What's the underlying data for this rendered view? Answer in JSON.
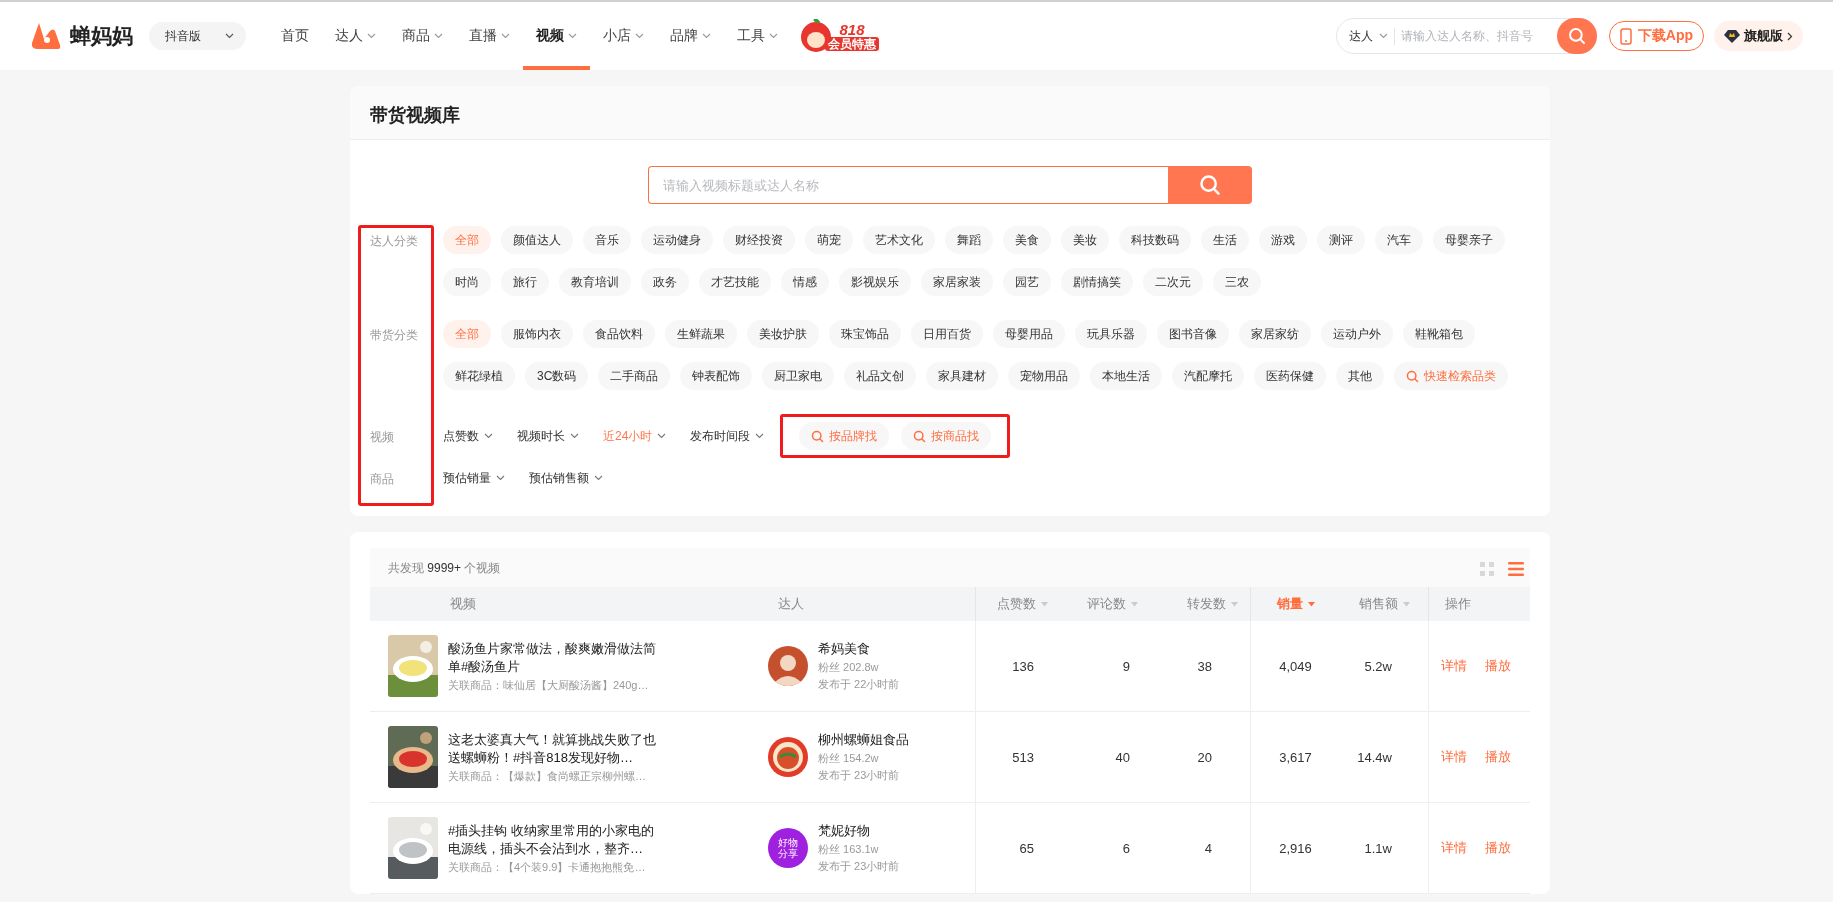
{
  "header": {
    "logo": "蝉妈妈",
    "platform": "抖音版",
    "nav": [
      {
        "label": "首页",
        "selected": false,
        "dropdown": false
      },
      {
        "label": "达人",
        "selected": false,
        "dropdown": true
      },
      {
        "label": "商品",
        "selected": false,
        "dropdown": true
      },
      {
        "label": "直播",
        "selected": false,
        "dropdown": true
      },
      {
        "label": "视频",
        "selected": true,
        "dropdown": true
      },
      {
        "label": "小店",
        "selected": false,
        "dropdown": true
      },
      {
        "label": "品牌",
        "selected": false,
        "dropdown": true
      },
      {
        "label": "工具",
        "selected": false,
        "dropdown": true
      }
    ],
    "promo": [
      "818",
      "会员特惠"
    ],
    "search": {
      "scope": "达人",
      "placeholder": "请输入达人名称、抖音号"
    },
    "download": "下载App",
    "edition": "旗舰版"
  },
  "library": {
    "title": "带货视频库",
    "search": {
      "placeholder": "请输入视频标题或达人名称"
    },
    "filters": [
      {
        "label": "达人分类",
        "kind": "chips",
        "options": [
          {
            "label": "全部",
            "selected": true
          },
          {
            "label": "颜值达人",
            "selected": false
          },
          {
            "label": "音乐",
            "selected": false
          },
          {
            "label": "运动健身",
            "selected": false
          },
          {
            "label": "财经投资",
            "selected": false
          },
          {
            "label": "萌宠",
            "selected": false
          },
          {
            "label": "艺术文化",
            "selected": false
          },
          {
            "label": "舞蹈",
            "selected": false
          },
          {
            "label": "美食",
            "selected": false
          },
          {
            "label": "美妆",
            "selected": false
          },
          {
            "label": "科技数码",
            "selected": false
          },
          {
            "label": "生活",
            "selected": false
          },
          {
            "label": "游戏",
            "selected": false
          },
          {
            "label": "测评",
            "selected": false
          },
          {
            "label": "汽车",
            "selected": false
          },
          {
            "label": "母婴亲子",
            "selected": false
          },
          {
            "label": "时尚",
            "selected": false
          },
          {
            "label": "旅行",
            "selected": false
          },
          {
            "label": "教育培训",
            "selected": false
          },
          {
            "label": "政务",
            "selected": false
          },
          {
            "label": "才艺技能",
            "selected": false
          },
          {
            "label": "情感",
            "selected": false
          },
          {
            "label": "影视娱乐",
            "selected": false
          },
          {
            "label": "家居家装",
            "selected": false
          },
          {
            "label": "园艺",
            "selected": false
          },
          {
            "label": "剧情搞笑",
            "selected": false
          },
          {
            "label": "二次元",
            "selected": false
          },
          {
            "label": "三农",
            "selected": false
          }
        ]
      },
      {
        "label": "带货分类",
        "kind": "chips",
        "options": [
          {
            "label": "全部",
            "selected": true
          },
          {
            "label": "服饰内衣",
            "selected": false
          },
          {
            "label": "食品饮料",
            "selected": false
          },
          {
            "label": "生鲜蔬果",
            "selected": false
          },
          {
            "label": "美妆护肤",
            "selected": false
          },
          {
            "label": "珠宝饰品",
            "selected": false
          },
          {
            "label": "日用百货",
            "selected": false
          },
          {
            "label": "母婴用品",
            "selected": false
          },
          {
            "label": "玩具乐器",
            "selected": false
          },
          {
            "label": "图书音像",
            "selected": false
          },
          {
            "label": "家居家纺",
            "selected": false
          },
          {
            "label": "运动户外",
            "selected": false
          },
          {
            "label": "鞋靴箱包",
            "selected": false
          },
          {
            "label": "鲜花绿植",
            "selected": false
          },
          {
            "label": "3C数码",
            "selected": false
          },
          {
            "label": "二手商品",
            "selected": false
          },
          {
            "label": "钟表配饰",
            "selected": false
          },
          {
            "label": "厨卫家电",
            "selected": false
          },
          {
            "label": "礼品文创",
            "selected": false
          },
          {
            "label": "家具建材",
            "selected": false
          },
          {
            "label": "宠物用品",
            "selected": false
          },
          {
            "label": "本地生活",
            "selected": false
          },
          {
            "label": "汽配摩托",
            "selected": false
          },
          {
            "label": "医药保健",
            "selected": false
          },
          {
            "label": "其他",
            "selected": false
          }
        ],
        "quick_search": "快速检索品类"
      },
      {
        "label": "视频",
        "kind": "dropdowns",
        "options": [
          {
            "label": "点赞数",
            "selected": false
          },
          {
            "label": "视频时长",
            "selected": false
          },
          {
            "label": "近24小时",
            "selected": true
          },
          {
            "label": "发布时间段",
            "selected": false
          }
        ],
        "search_buttons": [
          "按品牌找",
          "按商品找"
        ]
      },
      {
        "label": "商品",
        "kind": "dropdowns",
        "options": [
          {
            "label": "预估销量",
            "selected": false
          },
          {
            "label": "预估销售额",
            "selected": false
          }
        ]
      }
    ]
  },
  "results": {
    "count_prefix": "共发现",
    "count": "9999+",
    "count_suffix": "个视频",
    "views": [
      {
        "kind": "grid",
        "selected": false
      },
      {
        "kind": "list",
        "selected": true
      }
    ],
    "columns": [
      {
        "label": "视频",
        "sortable": false,
        "sorted": false
      },
      {
        "label": "达人",
        "sortable": false,
        "sorted": false
      },
      {
        "label": "点赞数",
        "sortable": true,
        "sorted": false
      },
      {
        "label": "评论数",
        "sortable": true,
        "sorted": false
      },
      {
        "label": "转发数",
        "sortable": true,
        "sorted": false
      },
      {
        "label": "销量",
        "sortable": true,
        "sorted": true
      },
      {
        "label": "销售额",
        "sortable": true,
        "sorted": false
      },
      {
        "label": "操作",
        "sortable": false,
        "sorted": false
      }
    ],
    "rows": [
      {
        "title": "酸汤鱼片家常做法，酸爽嫩滑做法简单#酸汤鱼片",
        "product": "关联商品：味仙居【大厨酸汤酱】240g…",
        "creator": "希妈美食",
        "fans": "粉丝 202.8w",
        "published": "发布于 22小时前",
        "avatar": {
          "kind": "figure"
        },
        "likes": "136",
        "comments": "9",
        "shares": "38",
        "sales": "4,049",
        "revenue": "5.2w",
        "actions": [
          "详情",
          "播放"
        ]
      },
      {
        "title": "这老太婆真大气！就算挑战失败了也送螺蛳粉！#抖音818发现好物…",
        "product": "关联商品：【爆款】食尚螺正宗柳州螺…",
        "creator": "柳州螺蛳姐食品",
        "fans": "粉丝 154.2w",
        "published": "发布于 23小时前",
        "avatar": {
          "kind": "picture"
        },
        "likes": "513",
        "comments": "40",
        "shares": "20",
        "sales": "3,617",
        "revenue": "14.4w",
        "actions": [
          "详情",
          "播放"
        ]
      },
      {
        "title": "#插头挂钩 收纳家里常用的小家电的电源线，插头不会沾到水，整齐…",
        "product": "关联商品：【4个装9.9】卡通抱抱熊免…",
        "creator": "梵妮好物",
        "fans": "粉丝 163.1w",
        "published": "发布于 23小时前",
        "avatar": {
          "kind": "text",
          "text": "好物分享"
        },
        "likes": "65",
        "comments": "6",
        "shares": "4",
        "sales": "2,916",
        "revenue": "1.1w",
        "actions": [
          "详情",
          "播放"
        ]
      }
    ]
  }
}
